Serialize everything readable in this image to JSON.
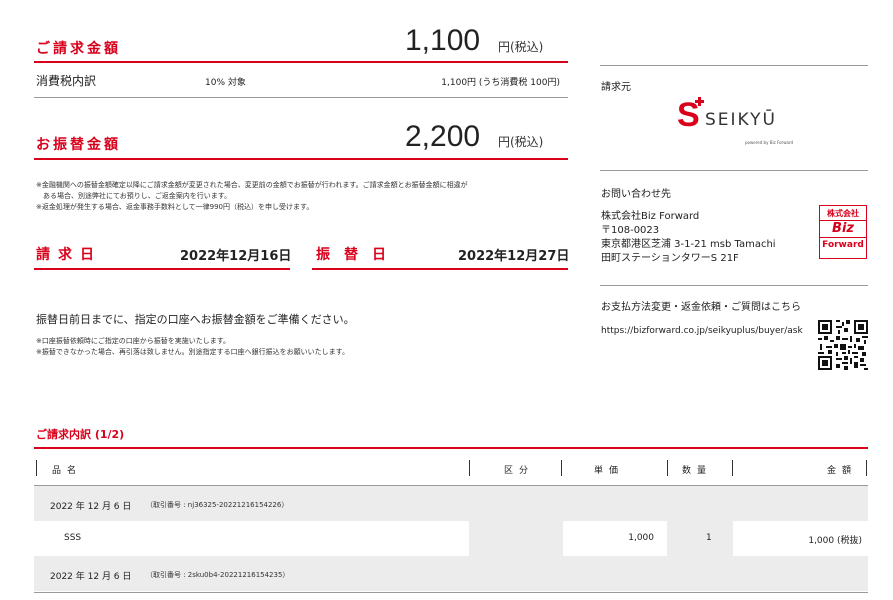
{
  "billing": {
    "label": "ご請求金額",
    "amount": "1,100",
    "unit": "円(税込)"
  },
  "tax": {
    "label": "消費税内訳",
    "target": "10% 対象",
    "detail": "1,100円 (うち消費税 100円)"
  },
  "transfer": {
    "label": "お振替金額",
    "amount": "2,200",
    "unit": "円(税込)"
  },
  "notes": [
    "※金融機関への振替金額確定以降にご請求金額が変更された場合、変更前の金額でお振替が行われます。ご請求金額とお振替金額に相違が",
    "　ある場合、別途弊社にてお預りし、ご返金案内を行います。",
    "※返金処理が発生する場合、返金事務手数料として一律990円（税込）を申し受けます。"
  ],
  "dates": {
    "invoice_label": "請求日",
    "invoice_date": "2022年12月16日",
    "transfer_label": "振替日",
    "transfer_date": "2022年12月27日"
  },
  "prepare": {
    "message": "振替日前日までに、指定の口座へお振替金額をご準備ください。",
    "notes": [
      "※口座振替依頼時にご指定の口座から振替を実施いたします。",
      "※振替できなかった場合、再引落は致しません。別途指定する口座へ銀行振込をお願いいたします。"
    ]
  },
  "issuer": {
    "label": "請求元",
    "logo_mark": "S",
    "logo_text": "SEIKYŪ",
    "logo_sub": "powered by Biz Forward"
  },
  "contact": {
    "label": "お問い合わせ先",
    "company": "株式会社Biz Forward",
    "postal": "〒108-0023",
    "address1": "東京都港区芝浦 3-1-21 msb Tamachi",
    "address2": "田町ステーションタワーS 21F",
    "seal_line1": "株式会社",
    "seal_line2": "Biz",
    "seal_line3": "Forward"
  },
  "payment": {
    "label": "お支払方法変更・返金依頼・ご質問はこちら",
    "url": "https://bizforward.co.jp/seikyuplus/buyer/ask"
  },
  "detail": {
    "title": "ご請求内訳 (1/2)",
    "headers": {
      "name": "品名",
      "category": "区分",
      "unit_price": "単価",
      "quantity": "数量",
      "amount": "金額"
    },
    "rows": [
      {
        "type": "date",
        "date": "2022 年 12 月 6 日",
        "txn": "（取引番号 : nj36325-20221216154226）"
      },
      {
        "type": "item",
        "name": "SSS",
        "category": "",
        "unit_price": "1,000",
        "quantity": "1",
        "amount": "1,000 (税抜)"
      },
      {
        "type": "date",
        "date": "2022 年 12 月 6 日",
        "txn": "（取引番号 : 2sku0b4-20221216154235）"
      }
    ]
  },
  "colors": {
    "accent": "#d9001b",
    "shade": "#ececec"
  }
}
